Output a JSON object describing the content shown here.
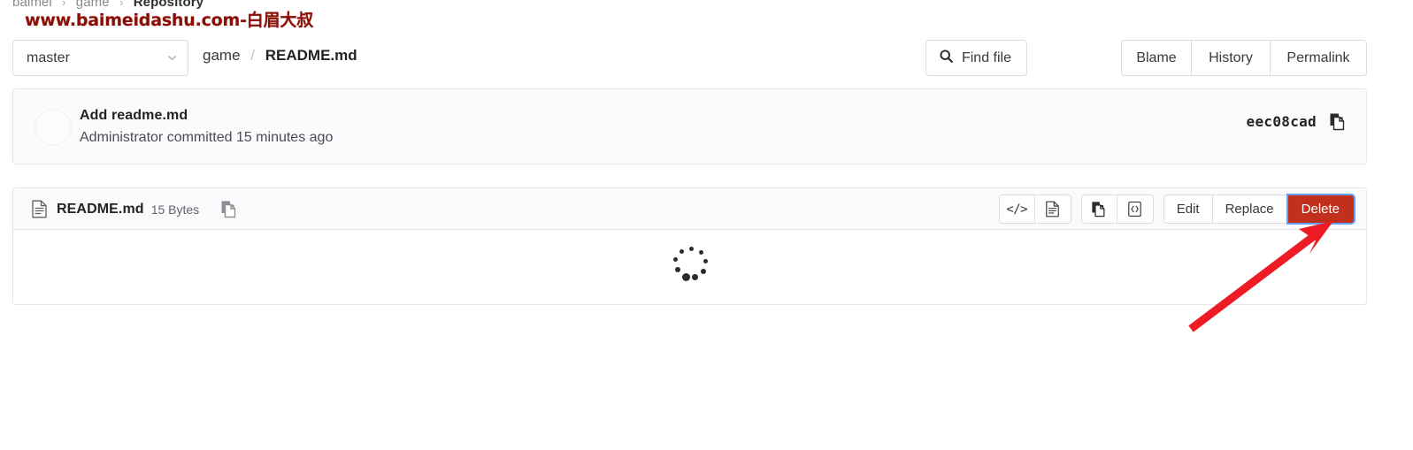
{
  "watermark": {
    "text": "www.baimeidashu.com-白眉大叔",
    "color": "#8a0f07"
  },
  "breadcrumb": {
    "items": [
      {
        "label": "baimei",
        "current": false
      },
      {
        "label": "game",
        "current": false
      },
      {
        "label": "Repository",
        "current": true
      }
    ],
    "separator": "›"
  },
  "toolbar": {
    "branch": {
      "value": "master",
      "icon": "chevron-down-icon"
    },
    "path": {
      "directory": "game",
      "separator": "/",
      "file": "README.md"
    },
    "find_file": {
      "label": "Find file",
      "icon": "search-icon"
    },
    "actions": [
      {
        "label": "Blame"
      },
      {
        "label": "History"
      },
      {
        "label": "Permalink"
      }
    ]
  },
  "commit": {
    "title": "Add readme.md",
    "meta": "Administrator committed 15 minutes ago",
    "sha": "eec08cad",
    "copy_icon": "copy-icon",
    "avatar": "avatar"
  },
  "file": {
    "name": "README.md",
    "size": "15 Bytes",
    "file_icon": "document-icon",
    "copy_icon": "copy-path-icon",
    "icon_buttons": [
      {
        "name": "display-source-button",
        "icon": "code-icon",
        "glyph": "</>"
      },
      {
        "name": "display-rendered-button",
        "icon": "document-icon"
      },
      {
        "name": "copy-contents-button",
        "icon": "copy-icon"
      },
      {
        "name": "open-in-web-ide-button",
        "icon": "web-ide-icon"
      }
    ],
    "text_buttons": [
      {
        "name": "edit-button",
        "label": "Edit",
        "variant": "default"
      },
      {
        "name": "replace-button",
        "label": "Replace",
        "variant": "default"
      },
      {
        "name": "delete-button",
        "label": "Delete",
        "variant": "danger"
      }
    ],
    "body_state": "loading",
    "spinner_icon": "loading-spinner"
  },
  "annotation": {
    "arrow": {
      "color": "#ed1c24",
      "points_to": "delete-button"
    }
  },
  "colors": {
    "danger": "#c1301c",
    "focus_ring": "#64a1f4",
    "panel_bg": "#fbfafd",
    "border": "#e6e5e9",
    "text": "#232326",
    "muted": "#646369",
    "watermark": "#8a0f07"
  }
}
